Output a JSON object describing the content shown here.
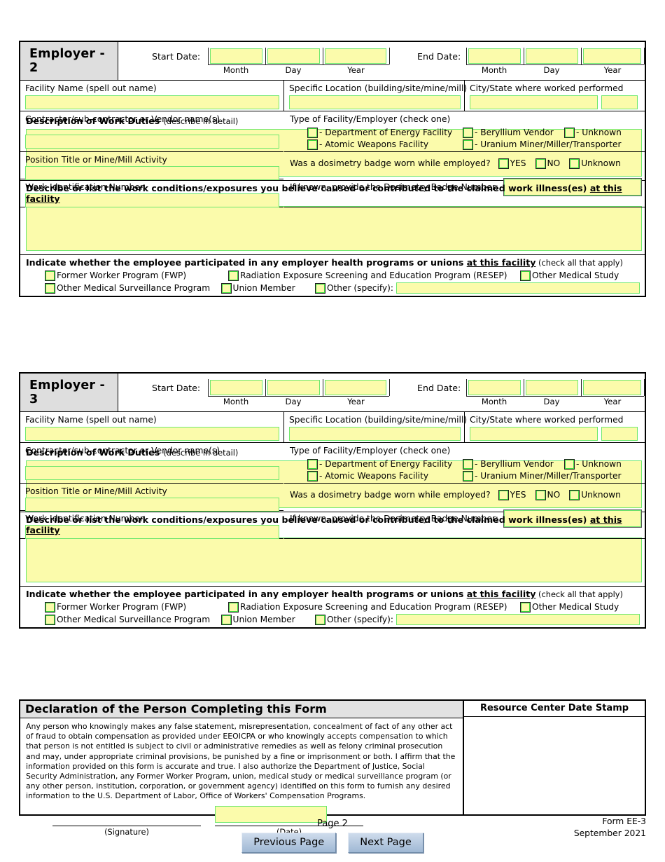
{
  "form": {
    "id_line1": "Form EE-3",
    "id_line2": "September 2021",
    "page_label": "Page 2"
  },
  "nav": {
    "previous_label": "Previous Page",
    "next_label": "Next Page"
  },
  "labels": {
    "start_date": "Start Date:",
    "end_date": "End Date:",
    "month": "Month",
    "day": "Day",
    "year": "Year",
    "facility_name": "Facility Name (spell out name)",
    "facility_name_alt": "Facility Name  (spell out name)",
    "specific_location": "Specific Location (building/site/mine/mill)",
    "city_state": "City/State where worked performed",
    "contractor": "Contractor/sub-contractor or Vendor name(s)",
    "position_title": "Position Title or Mine/Mill Activity",
    "work_id": "Work Identification Number",
    "facility_type": "Type of Facility/Employer (check one)",
    "dosimetry_question": "Was a dosimetry badge worn while employed?",
    "dosimetry_number": "If known, provide the Dosimetry Badge Number:",
    "work_duties_bold": "Description of Work Duties",
    "work_duties_small": "(describe in detail)",
    "conditions_main": "Describe or list the work conditions/exposures you believe caused or contributed to the claimed work illness(es) ",
    "conditions_underline": "at this facility",
    "programs_main_a": "Indicate whether the employee participated in any employer health programs or unions ",
    "programs_underline": "at this facility",
    "programs_main_b": "  (check all that apply)",
    "other_specify": "Other (specify):"
  },
  "facility_type_options": [
    "- Department of Energy Facility",
    "- Beryllium Vendor",
    "- Unknown",
    "- Atomic Weapons Facility",
    "- Uranium Miner/Miller/Transporter"
  ],
  "dosimetry_options": [
    "YES",
    "NO",
    "Unknown"
  ],
  "program_options": [
    "Former Worker Program (FWP)",
    "Radiation Exposure Screening and Education Program (RESEP)",
    "Other Medical Study",
    "Other Medical Surveillance Program",
    "Union Member"
  ],
  "employers": [
    {
      "title": "Employer - 2"
    },
    {
      "title": "Employer - 3"
    }
  ],
  "declaration": {
    "title": "Declaration of the Person Completing this Form",
    "body": "Any person who knowingly makes any false statement, misrepresentation, concealment of fact of any other act of fraud to obtain compensation as provided under EEOICPA or who knowingly accepts compensation to which that person is not entitled is subject to civil or administrative remedies as well as felony criminal prosecution and may, under appropriate criminal provisions, be punished by a fine or imprisonment or both.  I affirm that the information provided on this form is accurate and true.  I also authorize the Department of Justice, Social Security Administration, any Former Worker Program, union, medical study or medical surveillance program (or any other person, institution, corporation, or government agency) identified on this form to furnish any desired information to the U.S. Department of Labor, Office of Workers' Compensation Programs.",
    "signature_caption": "(Signature)",
    "date_caption": "(Date)",
    "stamp_title": "Resource Center Date Stamp"
  },
  "values": {
    "start_month": "",
    "start_day": "",
    "start_year": "",
    "end_month": "",
    "end_day": "",
    "end_year": "",
    "facility_name": "",
    "specific_location": "",
    "city": "",
    "state": "",
    "contractor": "",
    "position_title": "",
    "work_id": "",
    "dosimetry_badge_number": "",
    "work_duties": "",
    "conditions": "",
    "other_program": "",
    "signature_date": ""
  },
  "colors": {
    "field_fill": "#fbfbab",
    "field_border": "#6ee86e",
    "header_bg": "#dedede",
    "button": "#9fb8d4"
  }
}
